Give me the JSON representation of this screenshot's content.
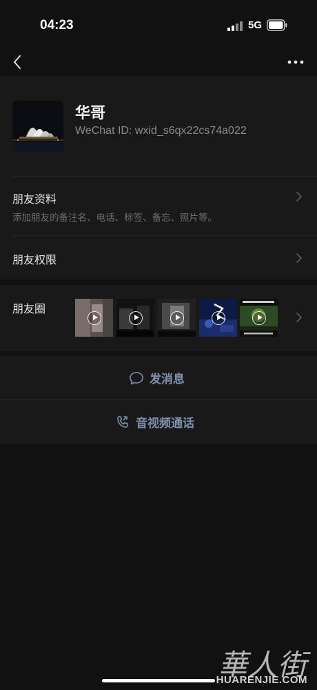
{
  "status_bar": {
    "time": "04:23",
    "network": "5G"
  },
  "nav": {
    "back_icon": "chevron-left-icon",
    "more_icon": "more-dots-icon"
  },
  "profile": {
    "name": "华哥",
    "wechat_id": "WeChat ID: wxid_s6qx22cs74a022",
    "avatar_desc": "sydney-opera-house-night-photo"
  },
  "friend_info": {
    "title": "朋友资料",
    "subtitle": "添加朋友的备注名、电话、标签、备忘、照片等。"
  },
  "friend_permissions": {
    "title": "朋友权限"
  },
  "moments": {
    "title": "朋友圈",
    "thumbnails": [
      {
        "kind": "video",
        "caption": ""
      },
      {
        "kind": "video",
        "caption": ""
      },
      {
        "kind": "video",
        "caption": ""
      },
      {
        "kind": "video",
        "caption": ""
      },
      {
        "kind": "video",
        "caption": ""
      }
    ]
  },
  "actions": {
    "message": {
      "label": "发消息",
      "icon": "chat-bubble-icon"
    },
    "call": {
      "label": "音视频通话",
      "icon": "phone-video-icon"
    }
  },
  "watermark": {
    "cn": "華人街",
    "en": "HUARENJIE.COM"
  },
  "colors": {
    "background": "#111111",
    "card": "#191919",
    "action_text": "#7d90aa",
    "secondary_text": "#8a8a8a"
  }
}
